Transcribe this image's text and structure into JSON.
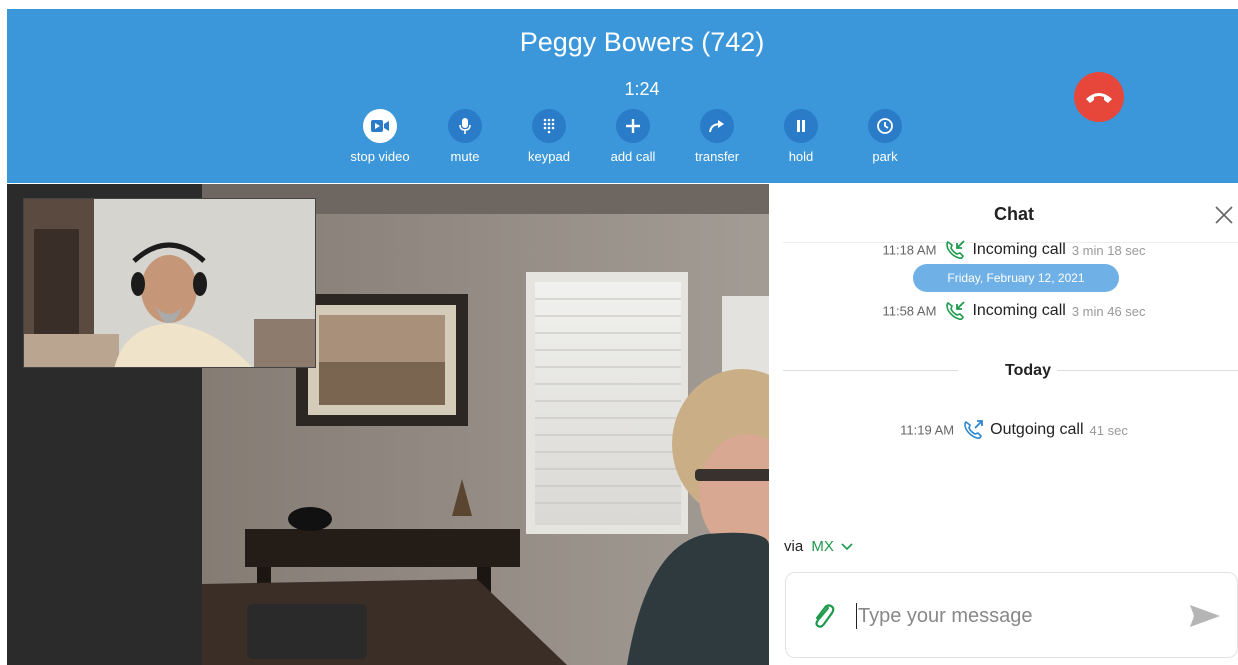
{
  "call": {
    "caller": "Peggy Bowers (742)",
    "timer": "1:24",
    "controls": [
      {
        "id": "stop-video",
        "label": "stop video",
        "icon": "video-camera-icon",
        "active": true
      },
      {
        "id": "mute",
        "label": "mute",
        "icon": "microphone-icon",
        "active": false
      },
      {
        "id": "keypad",
        "label": "keypad",
        "icon": "keypad-icon",
        "active": false
      },
      {
        "id": "add-call",
        "label": "add call",
        "icon": "plus-icon",
        "active": false
      },
      {
        "id": "transfer",
        "label": "transfer",
        "icon": "transfer-arrow-icon",
        "active": false
      },
      {
        "id": "hold",
        "label": "hold",
        "icon": "pause-icon",
        "active": false
      },
      {
        "id": "park",
        "label": "park",
        "icon": "clock-icon",
        "active": false
      }
    ],
    "hangup_icon": "hangup-phone-icon"
  },
  "chat": {
    "title": "Chat",
    "history": [
      {
        "time": "11:18 AM",
        "kind": "Incoming call",
        "duration": "3 min 18 sec",
        "direction": "incoming"
      },
      {
        "time": "11:58 AM",
        "kind": "Incoming call",
        "duration": "3 min 46 sec",
        "direction": "incoming"
      },
      {
        "time": "11:19 AM",
        "kind": "Outgoing call",
        "duration": "41 sec",
        "direction": "outgoing"
      }
    ],
    "date_pill": "Friday, February 12, 2021",
    "day_separator": "Today",
    "via_label": "via",
    "via_carrier": "MX",
    "placeholder": "Type your message"
  },
  "colors": {
    "callbar": "#3b97da",
    "control_circle": "#2a7bc8",
    "hangup": "#e7463a",
    "call_icon_green": "#1e9a4c",
    "date_pill": "#6fb0e6"
  }
}
